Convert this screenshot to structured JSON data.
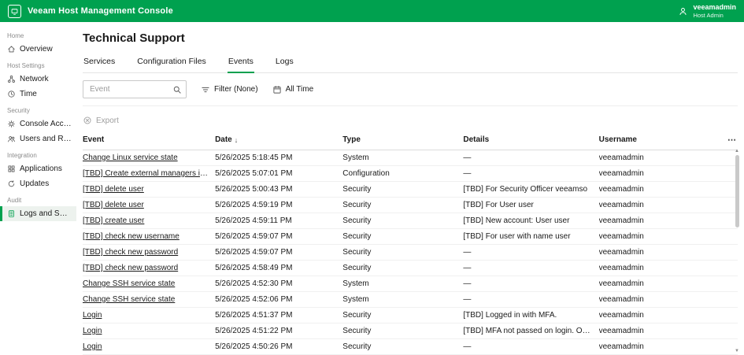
{
  "colors": {
    "brand_green": "#00a14f"
  },
  "icons": {
    "sort_desc": "↓",
    "overflow_menu": "⋯",
    "scroll_up": "▲",
    "scroll_down": "▼"
  },
  "topbar": {
    "app_title": "Veeam Host Management Console",
    "user_name": "veeamadmin",
    "user_role": "Host Admin"
  },
  "sidebar": {
    "sections": [
      {
        "label": "Home",
        "items": [
          {
            "label": "Overview"
          }
        ]
      },
      {
        "label": "Host Settings",
        "items": [
          {
            "label": "Network"
          },
          {
            "label": "Time"
          }
        ]
      },
      {
        "label": "Security",
        "items": [
          {
            "label": "Console Access"
          },
          {
            "label": "Users and Roles"
          }
        ]
      },
      {
        "label": "Integration",
        "items": [
          {
            "label": "Applications"
          },
          {
            "label": "Updates"
          }
        ]
      },
      {
        "label": "Audit",
        "items": [
          {
            "label": "Logs and Services"
          }
        ]
      }
    ]
  },
  "main": {
    "page_title": "Technical Support",
    "tabs": [
      {
        "label": "Services"
      },
      {
        "label": "Configuration Files"
      },
      {
        "label": "Events"
      },
      {
        "label": "Logs"
      }
    ],
    "toolbar": {
      "search_placeholder": "Event",
      "filter_label": "Filter (None)",
      "time_range_label": "All Time"
    },
    "export_label": "Export",
    "table": {
      "columns": [
        "Event",
        "Date",
        "Type",
        "Details",
        "Username"
      ],
      "sorted_by": "Date",
      "sort_direction": "desc",
      "rows": [
        [
          "Change Linux service state",
          "5/26/2025 5:18:45 PM",
          "System",
          "—",
          "veeamadmin"
        ],
        [
          "[TBD] Create external managers installation req...",
          "5/26/2025 5:07:01 PM",
          "Configuration",
          "—",
          "veeamadmin"
        ],
        [
          "[TBD] delete user",
          "5/26/2025 5:00:43 PM",
          "Security",
          "[TBD] For Security Officer veeamso",
          "veeamadmin"
        ],
        [
          "[TBD] delete user",
          "5/26/2025 4:59:19 PM",
          "Security",
          "[TBD] For User user",
          "veeamadmin"
        ],
        [
          "[TBD] create user",
          "5/26/2025 4:59:11 PM",
          "Security",
          "[TBD] New account: User user",
          "veeamadmin"
        ],
        [
          "[TBD] check new username",
          "5/26/2025 4:59:07 PM",
          "Security",
          "[TBD] For user with name user",
          "veeamadmin"
        ],
        [
          "[TBD] check new password",
          "5/26/2025 4:59:07 PM",
          "Security",
          "—",
          "veeamadmin"
        ],
        [
          "[TBD] check new password",
          "5/26/2025 4:58:49 PM",
          "Security",
          "—",
          "veeamadmin"
        ],
        [
          "Change SSH service state",
          "5/26/2025 4:52:30 PM",
          "System",
          "—",
          "veeamadmin"
        ],
        [
          "Change SSH service state",
          "5/26/2025 4:52:06 PM",
          "System",
          "—",
          "veeamadmin"
        ],
        [
          "Login",
          "5/26/2025 4:51:37 PM",
          "Security",
          "[TBD] Logged in with MFA.",
          "veeamadmin"
        ],
        [
          "Login",
          "5/26/2025 4:51:22 PM",
          "Security",
          "[TBD] MFA not passed on login. OTP is required.",
          "veeamadmin"
        ],
        [
          "Login",
          "5/26/2025 4:50:26 PM",
          "Security",
          "—",
          "veeamadmin"
        ]
      ]
    }
  }
}
